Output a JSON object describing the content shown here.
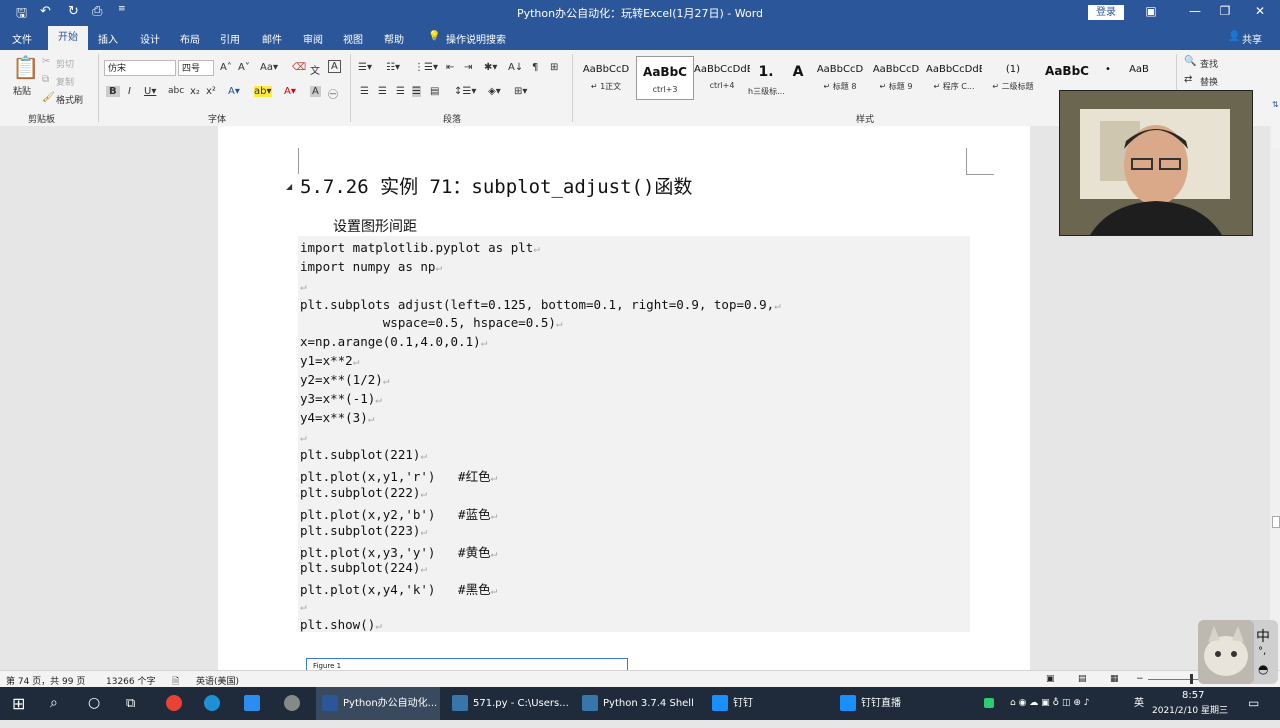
{
  "window": {
    "title": "Python办公自动化：玩转Excel(1月27日)  -  Word",
    "login": "登录",
    "share": "共享"
  },
  "tabs": [
    "文件",
    "开始",
    "插入",
    "设计",
    "布局",
    "引用",
    "邮件",
    "审阅",
    "视图",
    "帮助"
  ],
  "tell_me": "操作说明搜索",
  "ribbon": {
    "clipboard": {
      "paste": "粘贴",
      "cut": "剪切",
      "copy": "复制",
      "format_painter": "格式刷",
      "group": "剪贴板"
    },
    "font": {
      "name": "仿宋",
      "size": "四号",
      "group": "字体"
    },
    "paragraph": {
      "group": "段落"
    },
    "styles": {
      "group": "样式",
      "items": [
        {
          "preview": "AaBbCcD",
          "name": "↵ 1正文"
        },
        {
          "preview": "AaBbC",
          "name": "ctrl+3"
        },
        {
          "preview": "AaBbCcDdE",
          "name": "ctrl+4"
        },
        {
          "preview": "1.",
          "name": "h三级标..."
        },
        {
          "preview": "A",
          "name": ""
        },
        {
          "preview": "AaBbCcD",
          "name": "↵ 标题 8"
        },
        {
          "preview": "AaBbCcD",
          "name": "↵ 标题 9"
        },
        {
          "preview": "AaBbCcDdE",
          "name": "↵ 程序  C..."
        },
        {
          "preview": "(1)",
          "name": "↵ 二级标题"
        },
        {
          "preview": "AaBbC",
          "name": ""
        },
        {
          "preview": "•",
          "name": ""
        },
        {
          "preview": "AaB",
          "name": ""
        }
      ]
    },
    "editing": {
      "find": "查找",
      "replace": "替换"
    }
  },
  "document": {
    "heading": "5.7.26  实例 71：subplot_adjust()函数",
    "subheading": "设置图形间距",
    "code_lines": [
      "import matplotlib.pyplot as plt",
      "import numpy as np",
      "",
      "plt.subplots adjust(left=0.125, bottom=0.1, right=0.9, top=0.9,",
      "           wspace=0.5, hspace=0.5)",
      "x=np.arange(0.1,4.0,0.1)",
      "y1=x**2",
      "y2=x**(1/2)",
      "y3=x**(-1)",
      "y4=x**(3)",
      "",
      "plt.subplot(221)",
      "plt.plot(x,y1,'r')   #红色",
      "plt.subplot(222)",
      "plt.plot(x,y2,'b')   #蓝色",
      "plt.subplot(223)",
      "plt.plot(x,y3,'y')   #黄色",
      "plt.subplot(224)",
      "plt.plot(x,y4,'k')   #黑色",
      "",
      "plt.show()"
    ],
    "figure_title": "Figure 1"
  },
  "status": {
    "page": "第 74 页，共 99 页",
    "words": "13266 个字",
    "language": "英语(美国)"
  },
  "ime": {
    "mode": "中"
  },
  "taskbar": {
    "items": [
      {
        "label": "Python办公自动化...",
        "icon_color": "#2b579a"
      },
      {
        "label": "571.py - C:\\Users...",
        "icon_color": "#3776ab"
      },
      {
        "label": "Python 3.7.4 Shell",
        "icon_color": "#3776ab"
      },
      {
        "label": "钉钉",
        "icon_color": "#1890ff"
      },
      {
        "label": "钉钉直播",
        "icon_color": "#1890ff"
      }
    ],
    "time": "8:57",
    "date": "2021/2/10 星期三",
    "tray_lang": "英"
  }
}
